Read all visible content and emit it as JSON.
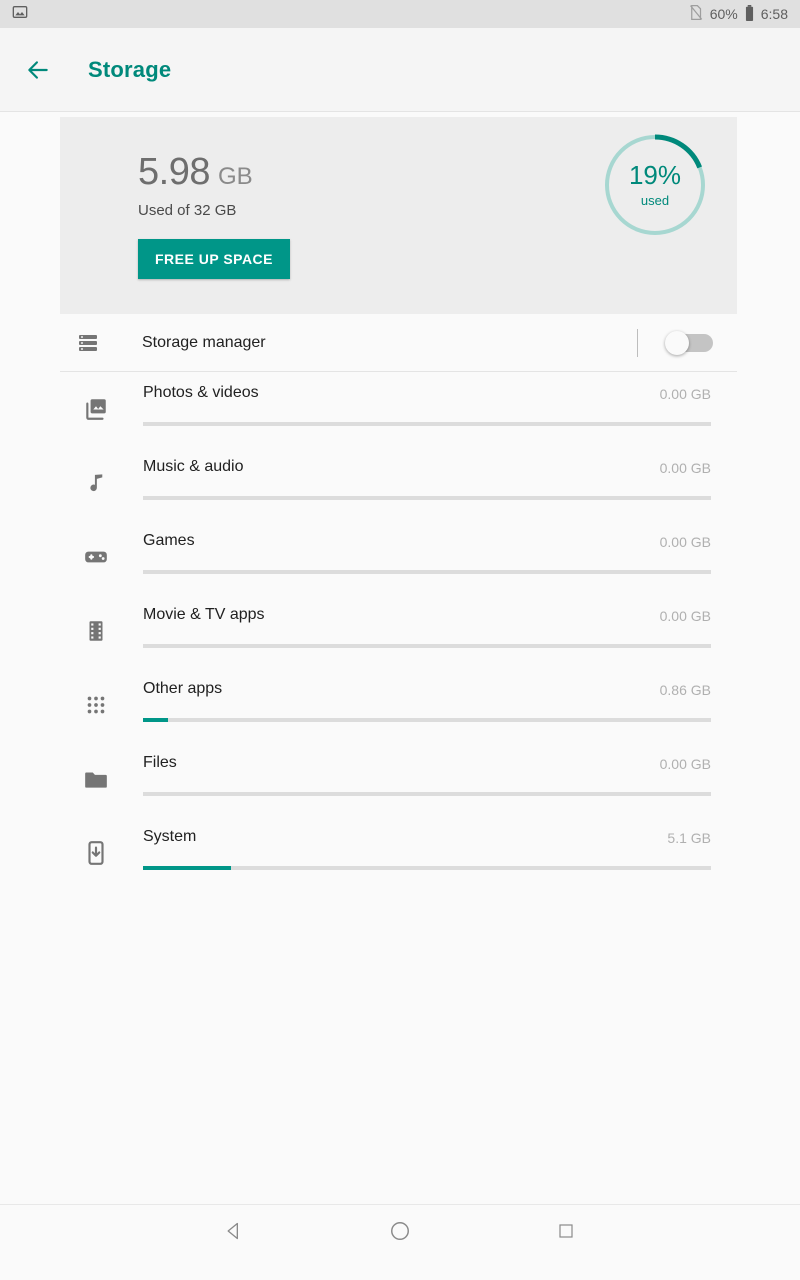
{
  "statusbar": {
    "left_icon": "image-notification-icon",
    "sim_icon": "no-sim-icon",
    "battery_text": "60%",
    "battery_icon": "battery-icon",
    "time": "6:58"
  },
  "appbar": {
    "back_icon": "back-arrow-icon",
    "title": "Storage",
    "accent_color": "#00897B"
  },
  "summary": {
    "used_number": "5.98",
    "used_unit": "GB",
    "used_of": "Used of 32 GB",
    "free_up_button": "FREE UP SPACE",
    "donut_percent": "19%",
    "donut_caption": "used",
    "donut_value": 19,
    "donut_track_color": "#A7D7D1",
    "donut_arc_color": "#00897B",
    "button_color": "#009688"
  },
  "storage_manager": {
    "icon": "storage-bars-icon",
    "label": "Storage manager",
    "toggle_state": "off"
  },
  "categories": [
    {
      "icon": "photo-library-icon",
      "label": "Photos & videos",
      "size": "0.00 GB",
      "fill_percent": 0
    },
    {
      "icon": "music-note-icon",
      "label": "Music & audio",
      "size": "0.00 GB",
      "fill_percent": 0
    },
    {
      "icon": "gamepad-icon",
      "label": "Games",
      "size": "0.00 GB",
      "fill_percent": 0
    },
    {
      "icon": "film-strip-icon",
      "label": "Movie & TV apps",
      "size": "0.00 GB",
      "fill_percent": 0
    },
    {
      "icon": "apps-grid-icon",
      "label": "Other apps",
      "size": "0.86 GB",
      "fill_percent": 4.4
    },
    {
      "icon": "folder-icon",
      "label": "Files",
      "size": "0.00 GB",
      "fill_percent": 0
    },
    {
      "icon": "system-update-icon",
      "label": "System",
      "size": "5.1 GB",
      "fill_percent": 15.5
    }
  ],
  "navbar": {
    "back": "nav-back-icon",
    "home": "nav-home-icon",
    "recents": "nav-recents-icon"
  }
}
